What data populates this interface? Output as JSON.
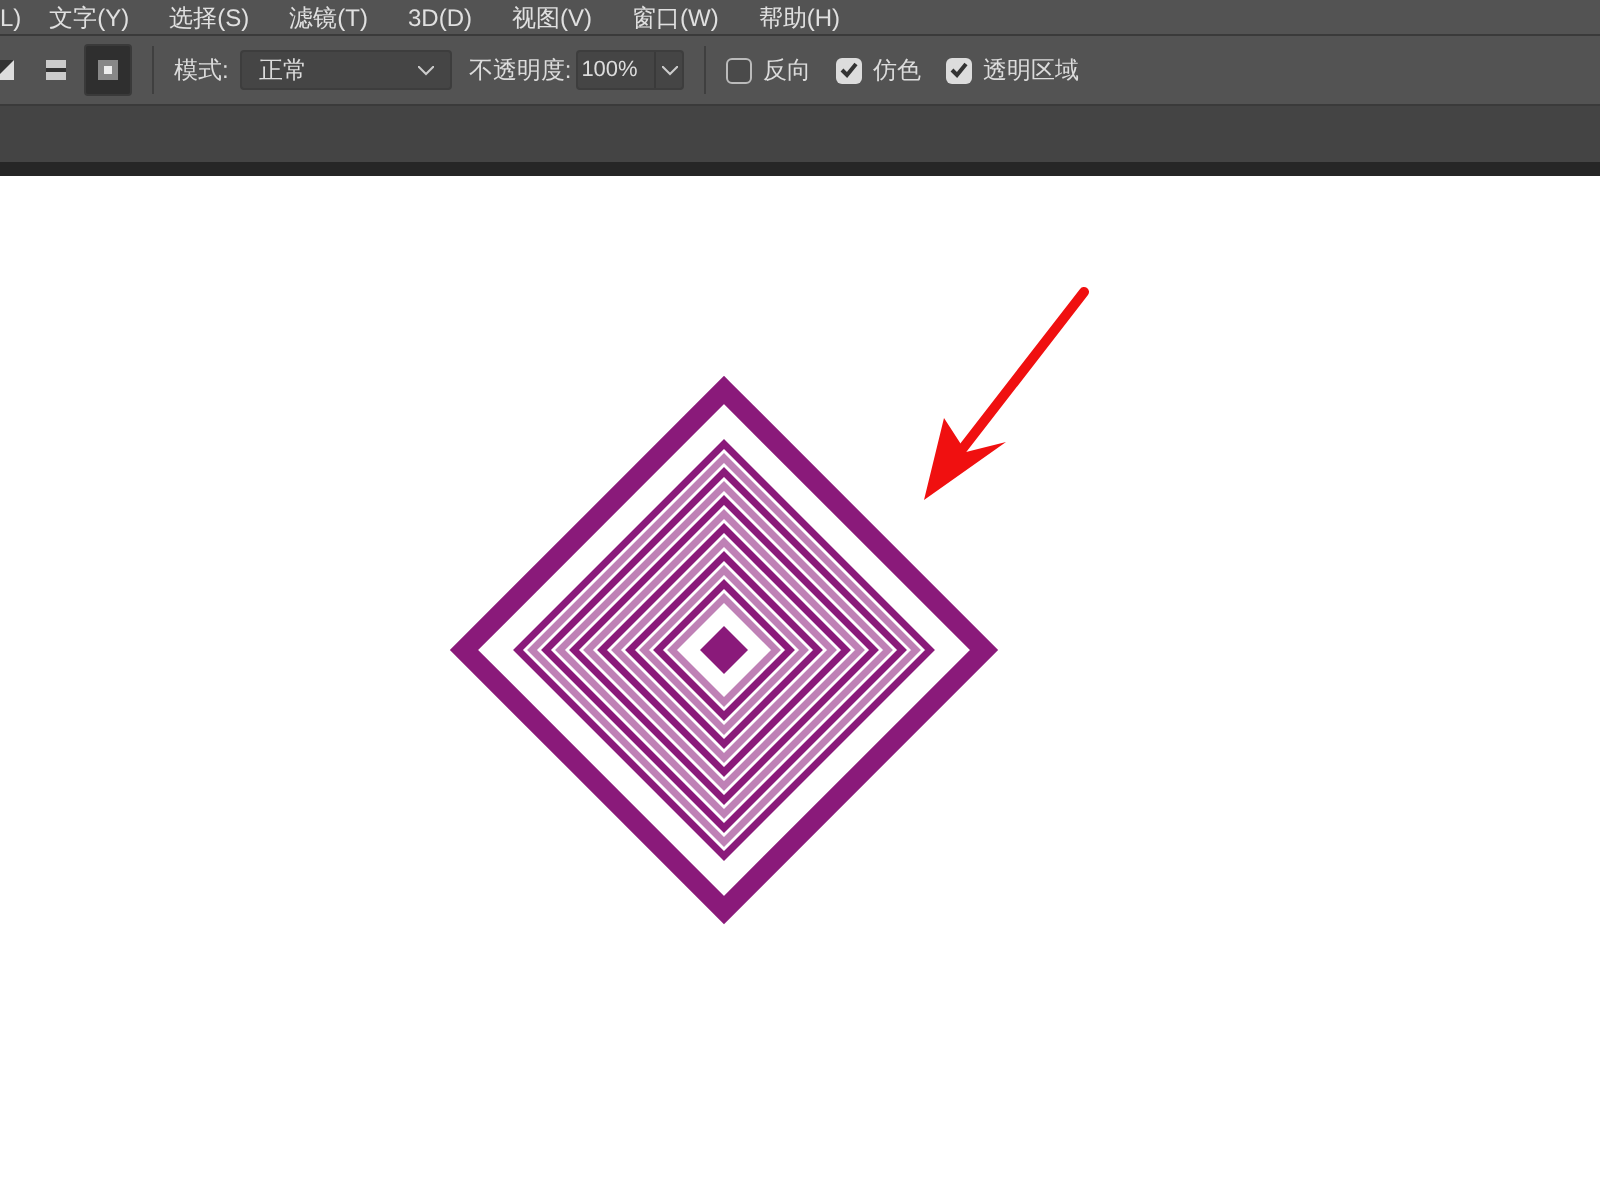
{
  "menu_bar": [
    "L)",
    "文字(Y)",
    "选择(S)",
    "滤镜(T)",
    "3D(D)",
    "视图(V)",
    "窗口(W)",
    "帮助(H)"
  ],
  "options_bar": {
    "gradient_types": [
      {
        "kind": "angle",
        "selected": false
      },
      {
        "kind": "reflected",
        "selected": false
      },
      {
        "kind": "diamond",
        "selected": true
      }
    ],
    "mode": {
      "label": "模式:",
      "value": "正常"
    },
    "opacity": {
      "label": "不透明度:",
      "value": "100%"
    },
    "checkboxes": [
      {
        "label": "反向",
        "checked": false
      },
      {
        "label": "仿色",
        "checked": true
      },
      {
        "label": "透明区域",
        "checked": true
      }
    ]
  }
}
